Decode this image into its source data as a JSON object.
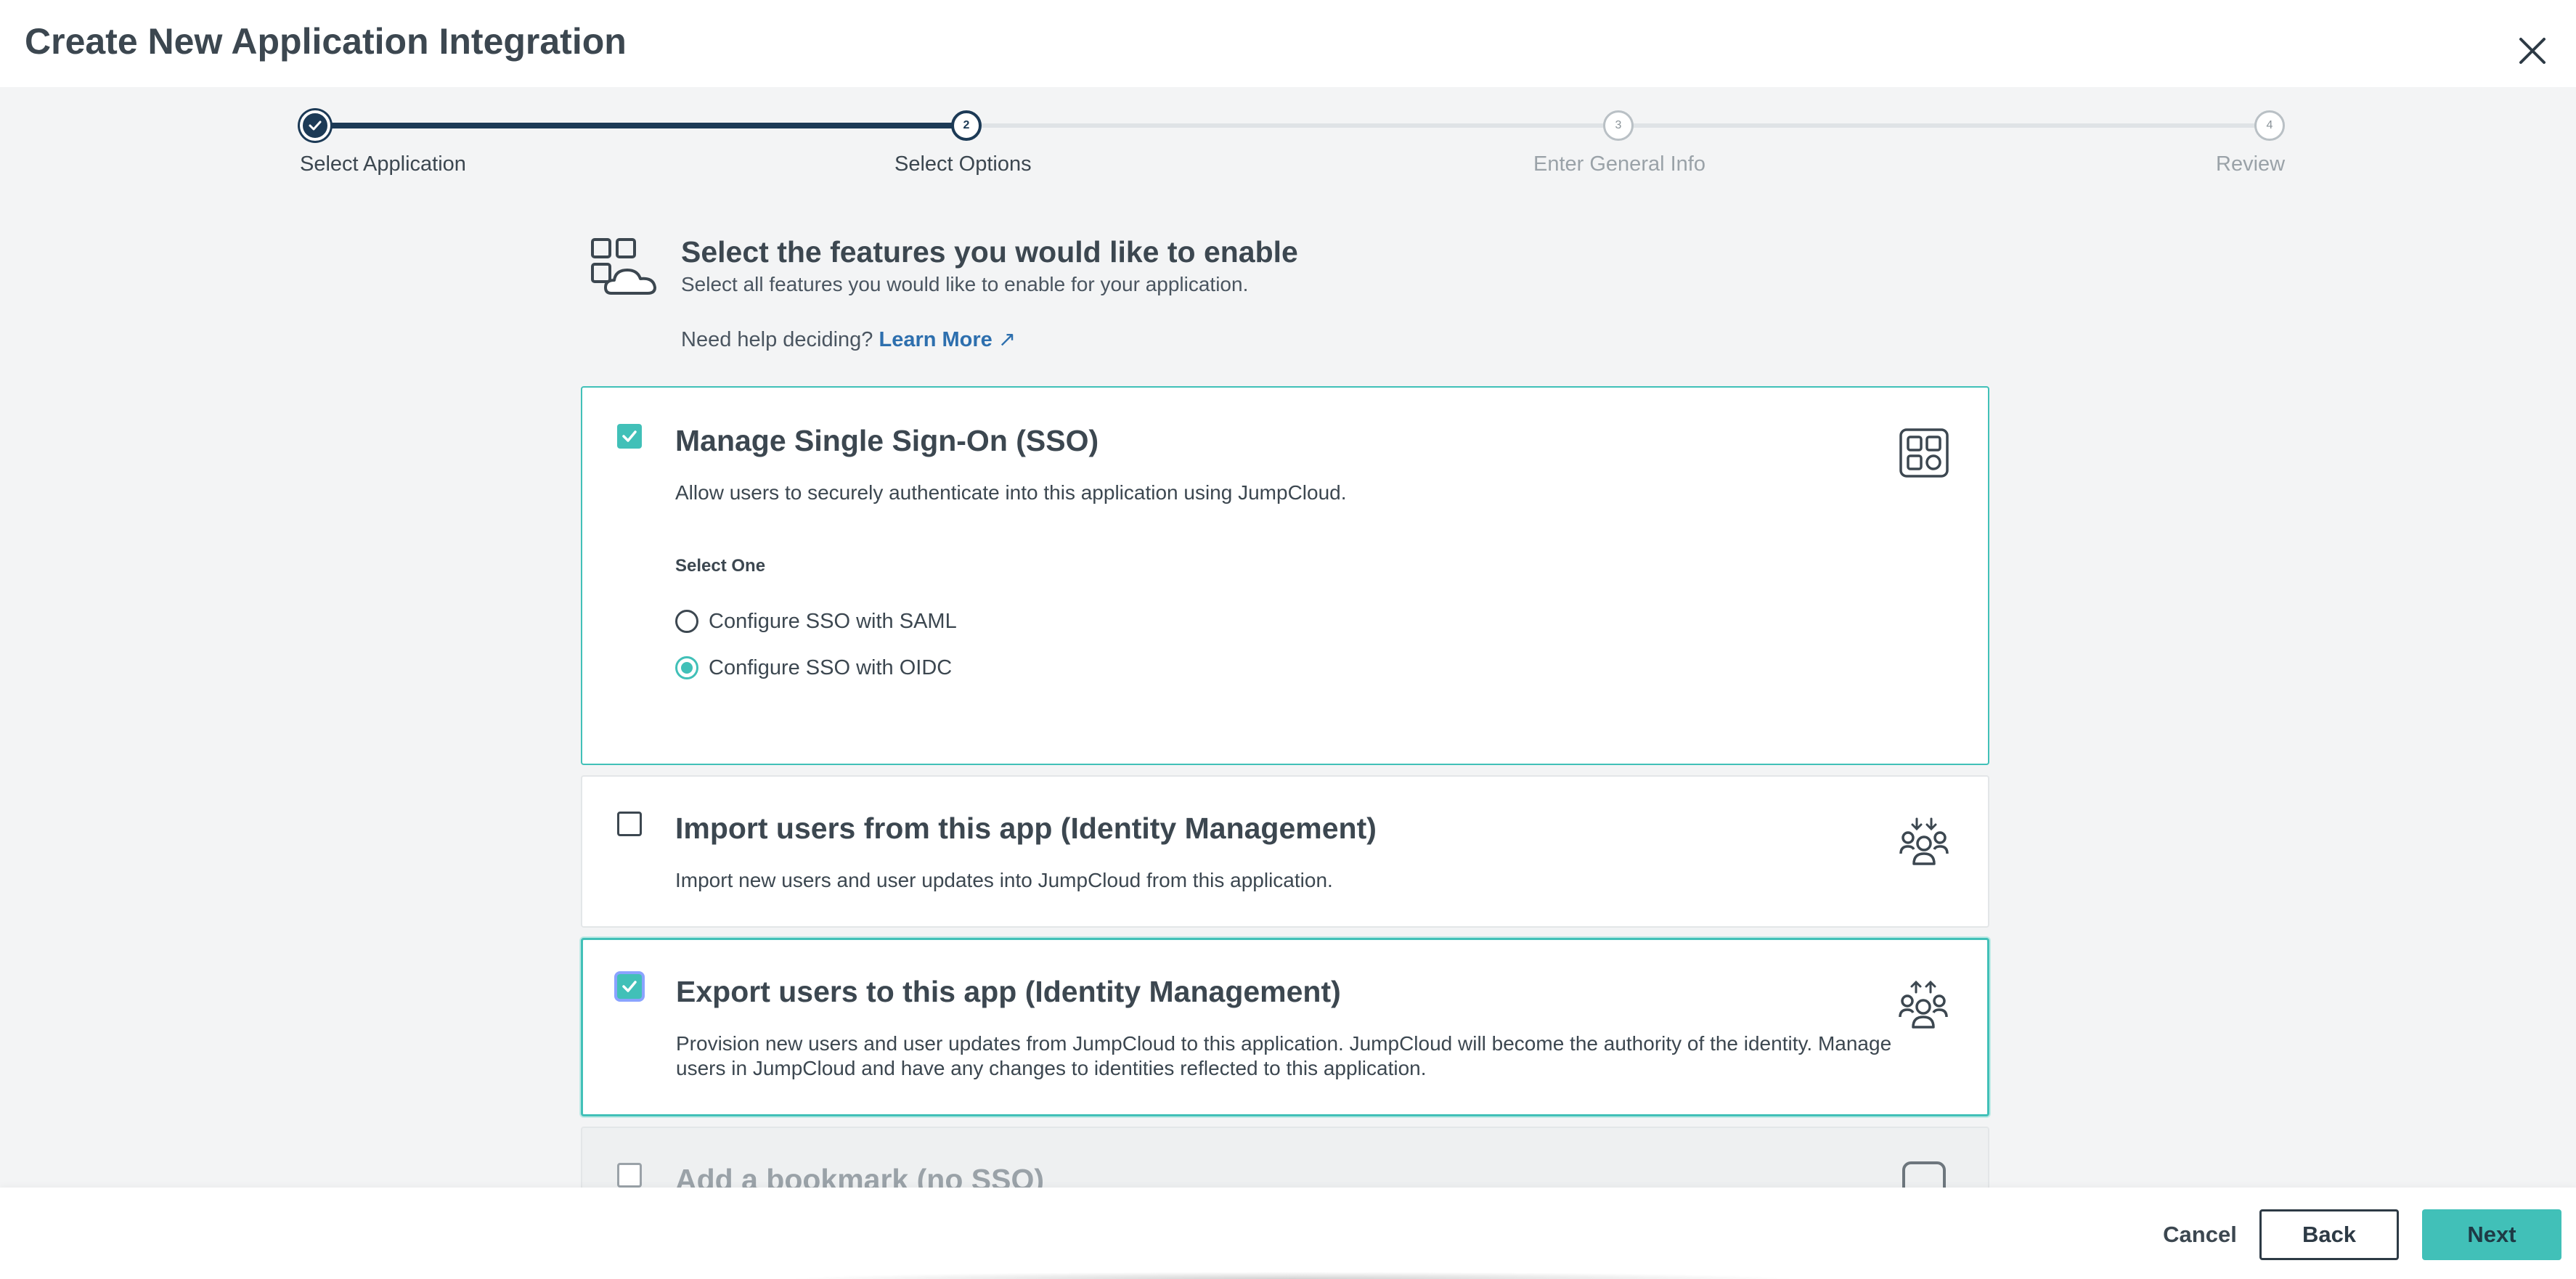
{
  "header": {
    "title": "Create New Application Integration"
  },
  "stepper": {
    "steps": [
      {
        "number": "1",
        "label": "Select Application",
        "state": "done"
      },
      {
        "number": "2",
        "label": "Select Options",
        "state": "active"
      },
      {
        "number": "3",
        "label": "Enter General Info",
        "state": "upcoming"
      },
      {
        "number": "4",
        "label": "Review",
        "state": "upcoming"
      }
    ]
  },
  "intro": {
    "title": "Select the features you would like to enable",
    "subtitle": "Select all features you would like to enable for your application.",
    "help_text": "Need help deciding?",
    "learn_more": "Learn More"
  },
  "features": [
    {
      "title": "Manage Single Sign-On (SSO)",
      "description": "Allow users to securely authenticate into this application using JumpCloud.",
      "checked": true,
      "icon": "grid-app-icon",
      "select_label": "Select One",
      "options": [
        {
          "label": "Configure SSO with SAML",
          "selected": false
        },
        {
          "label": "Configure SSO with OIDC",
          "selected": true
        }
      ]
    },
    {
      "title": "Import users from this app (Identity Management)",
      "description": "Import new users and user updates into JumpCloud from this application.",
      "checked": false,
      "icon": "users-import-icon"
    },
    {
      "title": "Export users to this app (Identity Management)",
      "description": "Provision new users and user updates from JumpCloud to this application. JumpCloud will become the authority of the identity. Manage users in JumpCloud and have any changes to identities reflected to this application.",
      "checked": true,
      "icon": "users-export-icon"
    },
    {
      "title": "Add a bookmark (no SSO)",
      "checked": false,
      "icon": "bookmark-icon"
    }
  ],
  "footer": {
    "cancel": "Cancel",
    "back": "Back",
    "next": "Next"
  },
  "colors": {
    "accent": "#41c0b8",
    "navy": "#1c3a56",
    "link": "#2d6fae"
  }
}
